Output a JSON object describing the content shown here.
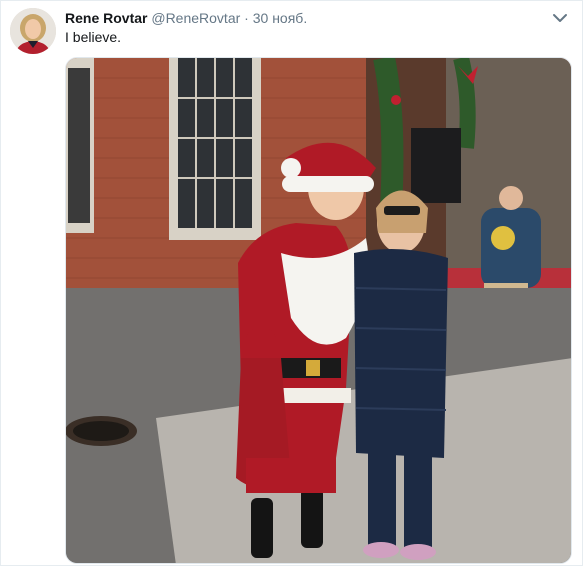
{
  "tweet": {
    "fullname": "Rene Rovtar",
    "username": "@ReneRovtar",
    "separator": "·",
    "timestamp": "30 нояб.",
    "text": "I believe.",
    "menu_icon": "chevron-down-icon"
  },
  "colors": {
    "name": "#14171a",
    "secondary": "#657786",
    "border": "#e6ecf0"
  }
}
